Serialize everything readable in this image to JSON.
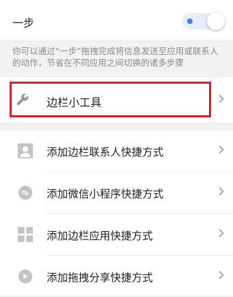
{
  "toggle": {
    "title": "一步",
    "enabled": true,
    "description": "你可以通过“一步”拖拽完成将信息发送至应用或联系人的动作，节省在不同应用之间切换的诸多步骤"
  },
  "gadget": {
    "label": "边栏小工具",
    "icon": "wrench-icon"
  },
  "shortcuts": [
    {
      "label": "添加边栏联系人快捷方式",
      "icon": "contact-person-icon"
    },
    {
      "label": "添加微信小程序快捷方式",
      "icon": "mini-program-icon"
    },
    {
      "label": "添加边栏应用快捷方式",
      "icon": "app-grid-icon"
    },
    {
      "label": "添加拖拽分享快捷方式",
      "icon": "share-arrow-icon"
    }
  ],
  "colors": {
    "highlight": "#d81e28",
    "accent": "#3d7ff5",
    "icon_gray": "#b5b5b5"
  }
}
